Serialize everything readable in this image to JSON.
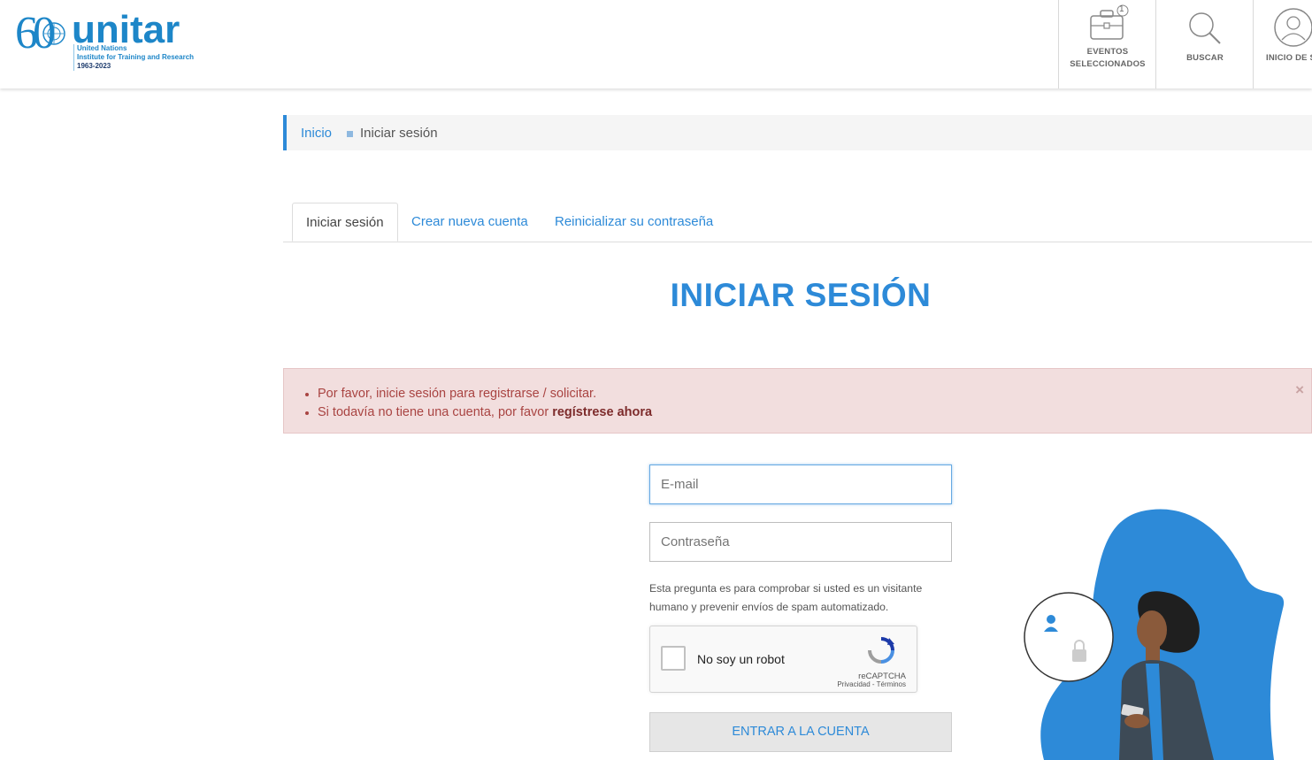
{
  "header": {
    "logo": {
      "sixty": "60",
      "word": "unitar",
      "line1": "United Nations",
      "line2": "Institute for Training and Research",
      "years": "1963-2023"
    },
    "nav": [
      {
        "line1": "EVENTOS",
        "line2": "SELECCIONADOS",
        "badge": "1",
        "icon": "briefcase-icon"
      },
      {
        "label": "BUSCAR",
        "icon": "search-icon"
      },
      {
        "label": "INICIO DE S",
        "icon": "user-icon"
      }
    ]
  },
  "breadcrumb": {
    "home": "Inicio",
    "current": "Iniciar sesión"
  },
  "tabs": [
    "Iniciar sesión",
    "Crear nueva cuenta",
    "Reinicializar su contraseña"
  ],
  "page_title": "INICIAR SESIÓN",
  "alert": {
    "line1": "Por favor, inicie sesión para registrarse / solicitar.",
    "line2_prefix": "Si todavía no tiene una cuenta, por favor ",
    "line2_link": "regístrese ahora",
    "close": "×"
  },
  "form": {
    "email_placeholder": "E-mail",
    "password_placeholder": "Contraseña",
    "hint": "Esta pregunta es para comprobar si usted es un visitante humano y prevenir envíos de spam automatizado.",
    "captcha": {
      "label": "No soy un robot",
      "brand": "reCAPTCHA",
      "links": "Privacidad - Términos"
    },
    "submit": "ENTRAR A LA CUENTA"
  },
  "colors": {
    "accent": "#2d8ad8",
    "brand": "#1d86c8",
    "alert_bg": "#f2dede",
    "alert_text": "#a94442"
  }
}
